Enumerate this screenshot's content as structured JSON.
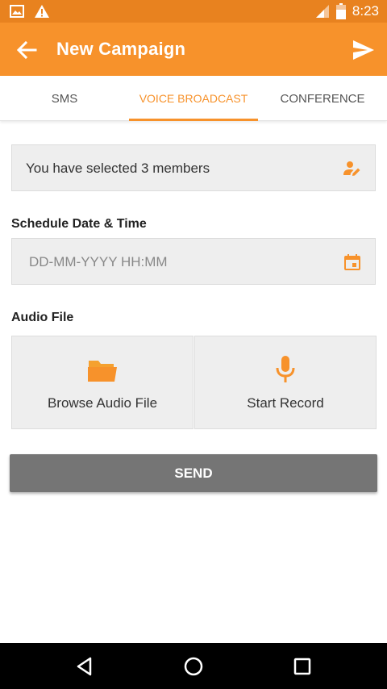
{
  "status_bar": {
    "time": "8:23",
    "icons": [
      "image-icon",
      "warning-icon",
      "signal-icon",
      "battery-icon"
    ]
  },
  "app_bar": {
    "title": "New Campaign",
    "back_icon": "arrow-left-icon",
    "send_icon": "send-icon"
  },
  "tabs": [
    {
      "label": "SMS",
      "active": false
    },
    {
      "label": "VOICE BROADCAST",
      "active": true
    },
    {
      "label": "CONFERENCE",
      "active": false
    }
  ],
  "members": {
    "text": "You have selected 3 members",
    "icon": "edit-person-icon"
  },
  "schedule": {
    "label": "Schedule Date & Time",
    "placeholder": "DD-MM-YYYY HH:MM",
    "icon": "calendar-icon"
  },
  "audio": {
    "label": "Audio File",
    "browse_label": "Browse Audio File",
    "browse_icon": "folder-icon",
    "record_label": "Start Record",
    "record_icon": "microphone-icon"
  },
  "send_button": {
    "label": "SEND"
  },
  "colors": {
    "primary": "#f7922b",
    "status_bar": "#e8821f",
    "send_button": "#757575"
  },
  "nav_bar": {
    "icons": [
      "nav-back-icon",
      "nav-home-icon",
      "nav-recent-icon"
    ]
  }
}
